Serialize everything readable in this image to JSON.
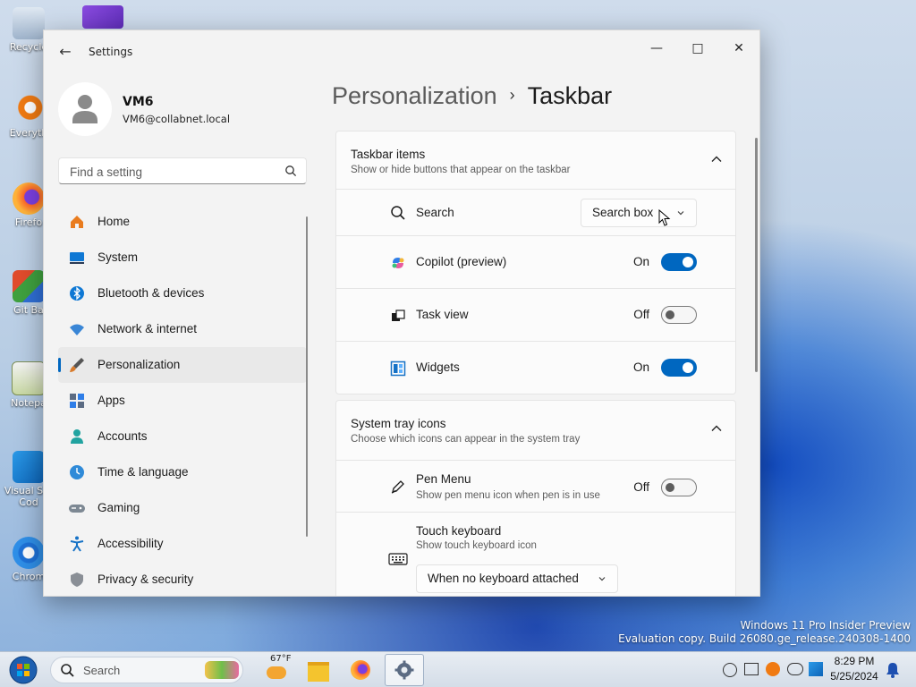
{
  "desktop": {
    "icons": [
      {
        "label": "Recycle"
      },
      {
        "label": "Everyth"
      },
      {
        "label": "Firefo"
      },
      {
        "label": "Git Ba"
      },
      {
        "label": "Notepa"
      },
      {
        "label": "Visual S… Cod"
      },
      {
        "label": "Chrom"
      }
    ],
    "watermark_line1": "Windows 11 Pro Insider Preview",
    "watermark_line2": "Evaluation copy. Build 26080.ge_release.240308-1400"
  },
  "window": {
    "title": "Settings",
    "minimize": "—",
    "maximize": "□",
    "close": "✕"
  },
  "profile": {
    "name": "VM6",
    "email": "VM6@collabnet.local"
  },
  "search": {
    "placeholder": "Find a setting"
  },
  "nav": [
    {
      "label": "Home",
      "icon": "home-icon",
      "color": "#e97c1f"
    },
    {
      "label": "System",
      "icon": "system-icon",
      "color": "#0f78d4"
    },
    {
      "label": "Bluetooth & devices",
      "icon": "bluetooth-icon",
      "color": "#0f78d4"
    },
    {
      "label": "Network & internet",
      "icon": "wifi-icon",
      "color": "#3a86d6"
    },
    {
      "label": "Personalization",
      "icon": "brush-icon",
      "color": "#d87b2c",
      "selected": true
    },
    {
      "label": "Apps",
      "icon": "apps-icon",
      "color": "#5b6b83"
    },
    {
      "label": "Accounts",
      "icon": "accounts-icon",
      "color": "#21a3a0"
    },
    {
      "label": "Time & language",
      "icon": "globe-clock-icon",
      "color": "#2f8ad8"
    },
    {
      "label": "Gaming",
      "icon": "gamepad-icon",
      "color": "#7d8893"
    },
    {
      "label": "Accessibility",
      "icon": "accessibility-icon",
      "color": "#1672c6"
    },
    {
      "label": "Privacy & security",
      "icon": "shield-icon",
      "color": "#8a8f96"
    }
  ],
  "breadcrumb": {
    "parent": "Personalization",
    "separator": "›",
    "current": "Taskbar"
  },
  "taskbar_items": {
    "title": "Taskbar items",
    "subtitle": "Show or hide buttons that appear on the taskbar",
    "search": {
      "label": "Search",
      "value": "Search box"
    },
    "copilot": {
      "label": "Copilot (preview)",
      "state": "On"
    },
    "taskview": {
      "label": "Task view",
      "state": "Off"
    },
    "widgets": {
      "label": "Widgets",
      "state": "On"
    }
  },
  "system_tray": {
    "title": "System tray icons",
    "subtitle": "Choose which icons can appear in the system tray",
    "pen": {
      "label": "Pen Menu",
      "sub": "Show pen menu icon when pen is in use",
      "state": "Off"
    },
    "touch": {
      "label": "Touch keyboard",
      "sub": "Show touch keyboard icon",
      "value": "When no keyboard attached"
    }
  },
  "taskbar": {
    "search_label": "Search",
    "weather_temp": "67°F",
    "time": "8:29 PM",
    "date": "5/25/2024"
  },
  "colors": {
    "accent": "#0067c0"
  }
}
